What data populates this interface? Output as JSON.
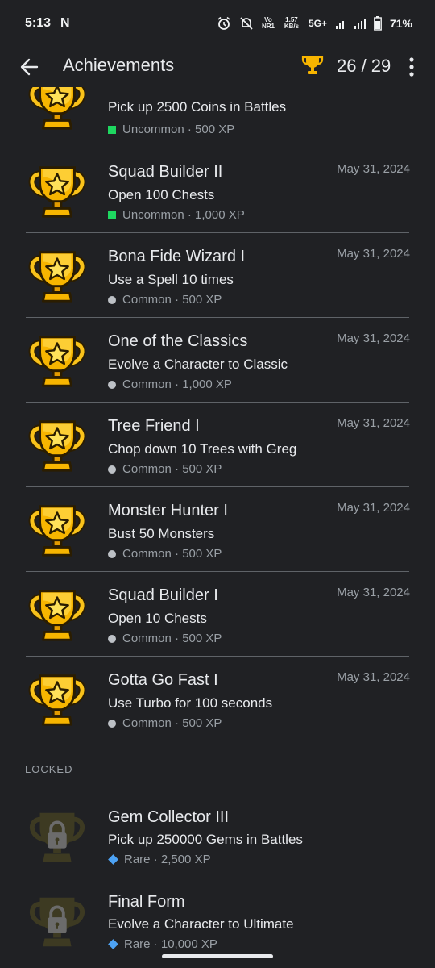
{
  "status_bar": {
    "time": "5:13",
    "notif_letter": "N",
    "volte": "Vo NR1",
    "data_rate": "1.57 KB/s",
    "network": "5G+",
    "battery": "71%"
  },
  "appbar": {
    "title": "Achievements",
    "count": "26 / 29"
  },
  "colors": {
    "uncommon": "#1ed760",
    "common": "#bdc1c6",
    "rare": "#4da3f5",
    "trophy": "#f7b500"
  },
  "items": [
    {
      "name": "",
      "desc": "Pick up 2500 Coins in Battles",
      "rarity": "Uncommon",
      "xp": "500 XP",
      "date": ""
    },
    {
      "name": "Squad Builder II",
      "desc": "Open 100 Chests",
      "rarity": "Uncommon",
      "xp": "1,000 XP",
      "date": "May 31, 2024"
    },
    {
      "name": "Bona Fide Wizard I",
      "desc": "Use a Spell 10 times",
      "rarity": "Common",
      "xp": "500 XP",
      "date": "May 31, 2024"
    },
    {
      "name": "One of the Classics",
      "desc": "Evolve a Character to Classic",
      "rarity": "Common",
      "xp": "1,000 XP",
      "date": "May 31, 2024"
    },
    {
      "name": "Tree Friend I",
      "desc": "Chop down 10 Trees with Greg",
      "rarity": "Common",
      "xp": "500 XP",
      "date": "May 31, 2024"
    },
    {
      "name": "Monster Hunter I",
      "desc": "Bust 50 Monsters",
      "rarity": "Common",
      "xp": "500 XP",
      "date": "May 31, 2024"
    },
    {
      "name": "Squad Builder I",
      "desc": "Open 10 Chests",
      "rarity": "Common",
      "xp": "500 XP",
      "date": "May 31, 2024"
    },
    {
      "name": "Gotta Go Fast I",
      "desc": "Use Turbo for 100 seconds",
      "rarity": "Common",
      "xp": "500 XP",
      "date": "May 31, 2024"
    }
  ],
  "locked_label": "LOCKED",
  "locked_items": [
    {
      "name": "Gem Collector III",
      "desc": "Pick up 250000 Gems in Battles",
      "rarity": "Rare",
      "xp": "2,500 XP"
    },
    {
      "name": "Final Form",
      "desc": "Evolve a Character to Ultimate",
      "rarity": "Rare",
      "xp": "10,000 XP"
    }
  ]
}
